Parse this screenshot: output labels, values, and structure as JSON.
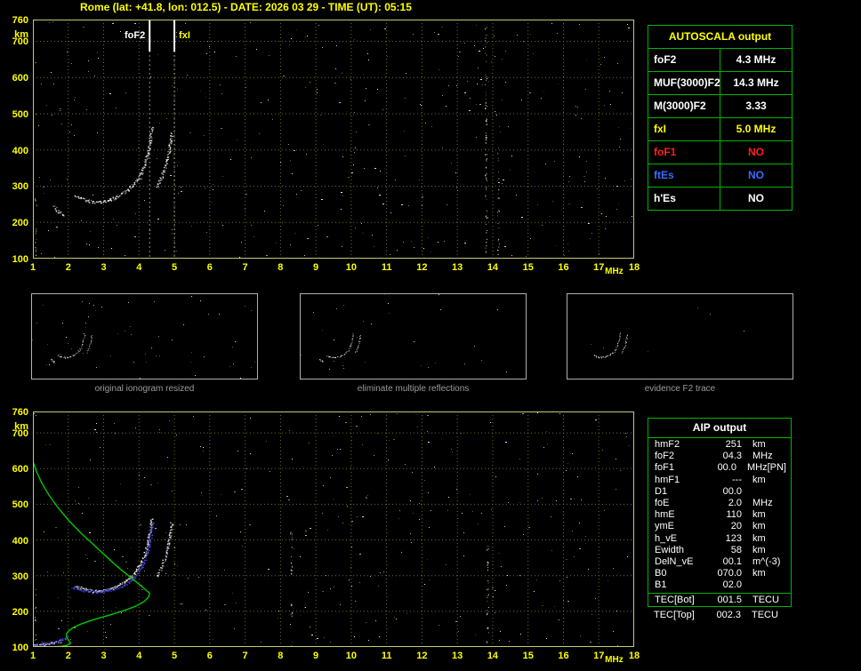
{
  "window": {
    "title": "Rome (lat: +41.8, lon: 012.5) - DATE: 2026 03 29 - TIME (UT): 05:15"
  },
  "colors": {
    "axis_text": "#ffff00",
    "plot_border": "#c8c878",
    "grid": "#6e6e28",
    "table_border": "#00b400",
    "trace": "#ffffff",
    "profile": "#00c800",
    "fit_blue": "#5050ff",
    "caption_gray": "#9a9a9a"
  },
  "autoscala_table": {
    "header": "AUTOSCALA output",
    "rows": [
      {
        "label": "foF2",
        "value": "4.3 MHz",
        "color": "#ffffff"
      },
      {
        "label": "MUF(3000)F2",
        "value": "14.3 MHz",
        "color": "#ffffff"
      },
      {
        "label": "M(3000)F2",
        "value": "3.33",
        "color": "#ffffff"
      },
      {
        "label": "fxI",
        "value": "5.0 MHz",
        "color": "#ffff00"
      },
      {
        "label": "foF1",
        "value": "NO",
        "color": "#ff2020"
      },
      {
        "label": "ftEs",
        "value": "NO",
        "color": "#3a6bff"
      },
      {
        "label": "h'Es",
        "value": "NO",
        "color": "#ffffff"
      }
    ]
  },
  "aip_table": {
    "header": "AIP output",
    "rows": [
      {
        "label": "hmF2",
        "value": "251",
        "unit": "km",
        "extra": ""
      },
      {
        "label": "foF2",
        "value": "04.3",
        "unit": "MHz",
        "extra": ""
      },
      {
        "label": "foF1",
        "value": "00.0",
        "unit": "MHz",
        "extra": "[PN]"
      },
      {
        "label": "hmF1",
        "value": "---",
        "unit": "km",
        "extra": ""
      },
      {
        "label": "D1",
        "value": "00.0",
        "unit": "",
        "extra": ""
      },
      {
        "label": "foE",
        "value": "2.0",
        "unit": "MHz",
        "extra": ""
      },
      {
        "label": "hmE",
        "value": "110",
        "unit": "km",
        "extra": ""
      },
      {
        "label": "ymE",
        "value": "20",
        "unit": "km",
        "extra": ""
      },
      {
        "label": "h_vE",
        "value": "123",
        "unit": "km",
        "extra": ""
      },
      {
        "label": "Ewidth",
        "value": "58",
        "unit": "km",
        "extra": ""
      },
      {
        "label": "DelN_vE",
        "value": "00.1",
        "unit": "m^(-3)",
        "extra": ""
      },
      {
        "label": "B0",
        "value": "070.0",
        "unit": "km",
        "extra": ""
      },
      {
        "label": "B1",
        "value": "02.0",
        "unit": "",
        "extra": ""
      }
    ],
    "tec_bot": {
      "label": "TEC[Bot]",
      "value": "001.5",
      "unit": "TECU"
    },
    "tec_top": {
      "label": "TEC[Top]",
      "value": "002.3",
      "unit": "TECU"
    }
  },
  "thumbnails": [
    {
      "caption": "original ionogram resized"
    },
    {
      "caption": "eliminate multiple reflections"
    },
    {
      "caption": "evidence F2 trace"
    }
  ],
  "chart_data": [
    {
      "id": "ionogram-top",
      "type": "scatter",
      "title": "autoscaled ionogram",
      "xlabel": "MHz",
      "ylabel": "km",
      "xlim": [
        1,
        18
      ],
      "ylim": [
        100,
        760
      ],
      "x_ticks": [
        1,
        2,
        3,
        4,
        5,
        6,
        7,
        8,
        9,
        10,
        11,
        12,
        13,
        14,
        15,
        16,
        17,
        18
      ],
      "y_ticks": [
        760,
        700,
        600,
        500,
        400,
        300,
        200,
        100
      ],
      "grid": true,
      "markers": [
        {
          "label": "foF2",
          "x_mhz": 4.3,
          "color": "#ffffff"
        },
        {
          "label": "fxI",
          "x_mhz": 5.0,
          "color": "#ffff00"
        }
      ],
      "series": [
        {
          "name": "F2-O-trace",
          "color": "#ffffff",
          "points": [
            [
              2.2,
              272
            ],
            [
              2.35,
              266
            ],
            [
              2.5,
              261
            ],
            [
              2.65,
              258
            ],
            [
              2.8,
              257
            ],
            [
              2.95,
              258
            ],
            [
              3.1,
              261
            ],
            [
              3.25,
              266
            ],
            [
              3.4,
              273
            ],
            [
              3.55,
              282
            ],
            [
              3.7,
              293
            ],
            [
              3.85,
              307
            ],
            [
              3.95,
              320
            ],
            [
              4.05,
              337
            ],
            [
              4.15,
              360
            ],
            [
              4.23,
              388
            ],
            [
              4.29,
              418
            ],
            [
              4.33,
              445
            ],
            [
              4.36,
              465
            ]
          ]
        },
        {
          "name": "F2-X-trace",
          "color": "#ffffff",
          "points": [
            [
              4.5,
              300
            ],
            [
              4.6,
              318
            ],
            [
              4.68,
              338
            ],
            [
              4.76,
              362
            ],
            [
              4.83,
              392
            ],
            [
              4.88,
              422
            ],
            [
              4.92,
              450
            ]
          ]
        },
        {
          "name": "low-echo-cluster",
          "color": "#ffffff",
          "points": [
            [
              1.6,
              243
            ],
            [
              1.68,
              234
            ],
            [
              1.76,
              227
            ],
            [
              1.84,
              222
            ],
            [
              1.9,
              219
            ]
          ]
        }
      ],
      "interference_columns": [
        {
          "x_mhz": 1.07,
          "km_range": [
            100,
            270
          ],
          "n": 16
        },
        {
          "x_mhz": 13.8,
          "km_range": [
            100,
            740
          ],
          "n": 65
        },
        {
          "x_mhz": 14.15,
          "km_range": [
            100,
            430
          ],
          "n": 22
        }
      ]
    },
    {
      "id": "profile-bottom",
      "type": "scatter",
      "title": "ionogram with AIP electron density profile",
      "xlabel": "MHz",
      "ylabel": "km",
      "xlim": [
        1,
        18
      ],
      "ylim": [
        100,
        760
      ],
      "x_ticks": [
        1,
        2,
        3,
        4,
        5,
        6,
        7,
        8,
        9,
        10,
        11,
        12,
        13,
        14,
        15,
        16,
        17,
        18
      ],
      "y_ticks": [
        760,
        700,
        600,
        500,
        400,
        300,
        200,
        100
      ],
      "grid": true,
      "markers": [],
      "series": [
        {
          "name": "F2-O-trace",
          "color": "#ffffff",
          "points": [
            [
              2.2,
              272
            ],
            [
              2.35,
              266
            ],
            [
              2.5,
              261
            ],
            [
              2.65,
              258
            ],
            [
              2.8,
              257
            ],
            [
              2.95,
              258
            ],
            [
              3.1,
              261
            ],
            [
              3.25,
              266
            ],
            [
              3.4,
              273
            ],
            [
              3.55,
              282
            ],
            [
              3.7,
              293
            ],
            [
              3.85,
              307
            ],
            [
              3.95,
              320
            ],
            [
              4.05,
              337
            ],
            [
              4.15,
              360
            ],
            [
              4.23,
              388
            ],
            [
              4.29,
              418
            ],
            [
              4.33,
              445
            ],
            [
              4.36,
              465
            ]
          ]
        },
        {
          "name": "F2-X-trace",
          "color": "#ffffff",
          "points": [
            [
              4.5,
              300
            ],
            [
              4.6,
              318
            ],
            [
              4.68,
              338
            ],
            [
              4.76,
              362
            ],
            [
              4.83,
              392
            ],
            [
              4.88,
              422
            ],
            [
              4.92,
              450
            ]
          ]
        },
        {
          "name": "E-trace-white",
          "color": "#ffffff",
          "points": [
            [
              1.0,
              104
            ],
            [
              1.2,
              106
            ],
            [
              1.4,
              109
            ],
            [
              1.6,
              113
            ],
            [
              1.8,
              118
            ]
          ]
        },
        {
          "name": "fitted-trace-blue",
          "color": "#5050ff",
          "points": [
            [
              2.1,
              268
            ],
            [
              2.4,
              260
            ],
            [
              2.7,
              255
            ],
            [
              3.0,
              256
            ],
            [
              3.3,
              263
            ],
            [
              3.6,
              276
            ],
            [
              3.9,
              300
            ],
            [
              4.1,
              330
            ],
            [
              4.25,
              370
            ],
            [
              4.33,
              415
            ],
            [
              4.37,
              450
            ]
          ]
        },
        {
          "name": "fitted-E-trace-blue",
          "color": "#5050ff",
          "points": [
            [
              1.05,
              107
            ],
            [
              1.25,
              109
            ],
            [
              1.45,
              112
            ],
            [
              1.65,
              116
            ],
            [
              1.85,
              122
            ],
            [
              2.0,
              130
            ]
          ]
        },
        {
          "name": "electron-density-profile",
          "type": "line",
          "color": "#00c800",
          "points": [
            [
              1.0,
              620
            ],
            [
              1.1,
              592
            ],
            [
              1.25,
              560
            ],
            [
              1.45,
              526
            ],
            [
              1.7,
              492
            ],
            [
              2.0,
              456
            ],
            [
              2.35,
              420
            ],
            [
              2.7,
              388
            ],
            [
              3.05,
              356
            ],
            [
              3.4,
              324
            ],
            [
              3.75,
              296
            ],
            [
              4.0,
              276
            ],
            [
              4.18,
              261
            ],
            [
              4.3,
              251
            ],
            [
              4.28,
              241
            ],
            [
              4.15,
              228
            ],
            [
              3.9,
              214
            ],
            [
              3.6,
              203
            ],
            [
              3.25,
              192
            ],
            [
              2.9,
              182
            ],
            [
              2.6,
              173
            ],
            [
              2.35,
              164
            ],
            [
              2.15,
              155
            ],
            [
              2.02,
              146
            ],
            [
              1.95,
              137
            ],
            [
              1.95,
              128
            ],
            [
              2.0,
              120
            ],
            [
              2.05,
              113
            ],
            [
              2.06,
              110
            ],
            [
              1.98,
              105
            ],
            [
              1.8,
              102
            ],
            [
              1.55,
              100.5
            ],
            [
              1.25,
              100
            ]
          ]
        }
      ],
      "interference_columns": [
        {
          "x_mhz": 1.07,
          "km_range": [
            100,
            250
          ],
          "n": 12
        },
        {
          "x_mhz": 8.3,
          "km_range": [
            100,
            430
          ],
          "n": 22
        },
        {
          "x_mhz": 13.85,
          "km_range": [
            100,
            400
          ],
          "n": 30
        }
      ]
    }
  ]
}
